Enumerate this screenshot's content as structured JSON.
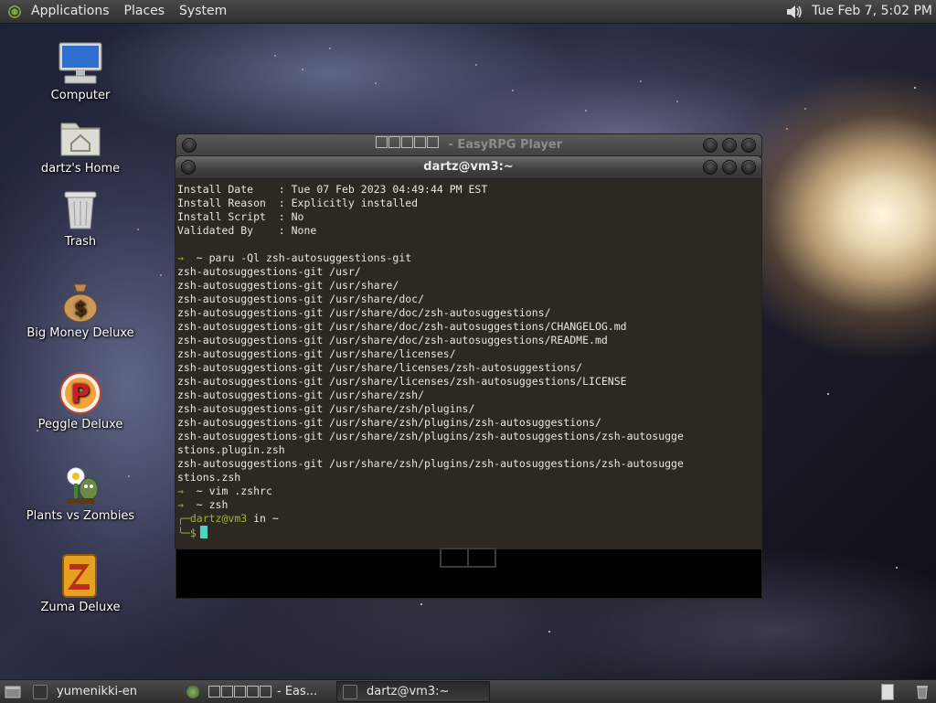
{
  "top_panel": {
    "menus": [
      "Applications",
      "Places",
      "System"
    ],
    "clock": "Tue Feb  7,  5:02 PM"
  },
  "desktop_icons": [
    {
      "label": "Computer",
      "icon": "computer-icon"
    },
    {
      "label": "dartz's Home",
      "icon": "home-folder-icon"
    },
    {
      "label": "Trash",
      "icon": "trash-icon"
    },
    {
      "label": "Big Money Deluxe",
      "icon": "money-bag-icon"
    },
    {
      "label": "Peggle Deluxe",
      "icon": "peggle-icon"
    },
    {
      "label": "Plants vs Zombies",
      "icon": "plants-vs-zombies-icon"
    },
    {
      "label": "Zuma Deluxe",
      "icon": "zuma-icon"
    }
  ],
  "easyrpg_window": {
    "title_suffix": " - EasyRPG Player"
  },
  "terminal_window": {
    "title": "dartz@vm3:~",
    "lines": [
      "Install Date    : Tue 07 Feb 2023 04:49:44 PM EST",
      "Install Reason  : Explicitly installed",
      "Install Script  : No",
      "Validated By    : None",
      "",
      "  ~ paru -Ql zsh-autosuggestions-git",
      "zsh-autosuggestions-git /usr/",
      "zsh-autosuggestions-git /usr/share/",
      "zsh-autosuggestions-git /usr/share/doc/",
      "zsh-autosuggestions-git /usr/share/doc/zsh-autosuggestions/",
      "zsh-autosuggestions-git /usr/share/doc/zsh-autosuggestions/CHANGELOG.md",
      "zsh-autosuggestions-git /usr/share/doc/zsh-autosuggestions/README.md",
      "zsh-autosuggestions-git /usr/share/licenses/",
      "zsh-autosuggestions-git /usr/share/licenses/zsh-autosuggestions/",
      "zsh-autosuggestions-git /usr/share/licenses/zsh-autosuggestions/LICENSE",
      "zsh-autosuggestions-git /usr/share/zsh/",
      "zsh-autosuggestions-git /usr/share/zsh/plugins/",
      "zsh-autosuggestions-git /usr/share/zsh/plugins/zsh-autosuggestions/",
      "zsh-autosuggestions-git /usr/share/zsh/plugins/zsh-autosuggestions/zsh-autosugge",
      "stions.plugin.zsh",
      "zsh-autosuggestions-git /usr/share/zsh/plugins/zsh-autosuggestions/zsh-autosugge",
      "stions.zsh",
      "  ~ vim .zshrc",
      "  ~ zsh"
    ],
    "prompt_user": "dartz@vm3",
    "prompt_rest": " in ~",
    "prompt_symbol": "$"
  },
  "taskbar": {
    "tasks": [
      {
        "label": "yumenikki-en",
        "active": false
      },
      {
        "label": "- Eas...",
        "active": false
      },
      {
        "label": "dartz@vm3:~",
        "active": true
      }
    ]
  },
  "colors": {
    "terminal_bg": "#2c2923",
    "prompt_green": "#9fb530",
    "cursor": "#4fd3c4"
  }
}
